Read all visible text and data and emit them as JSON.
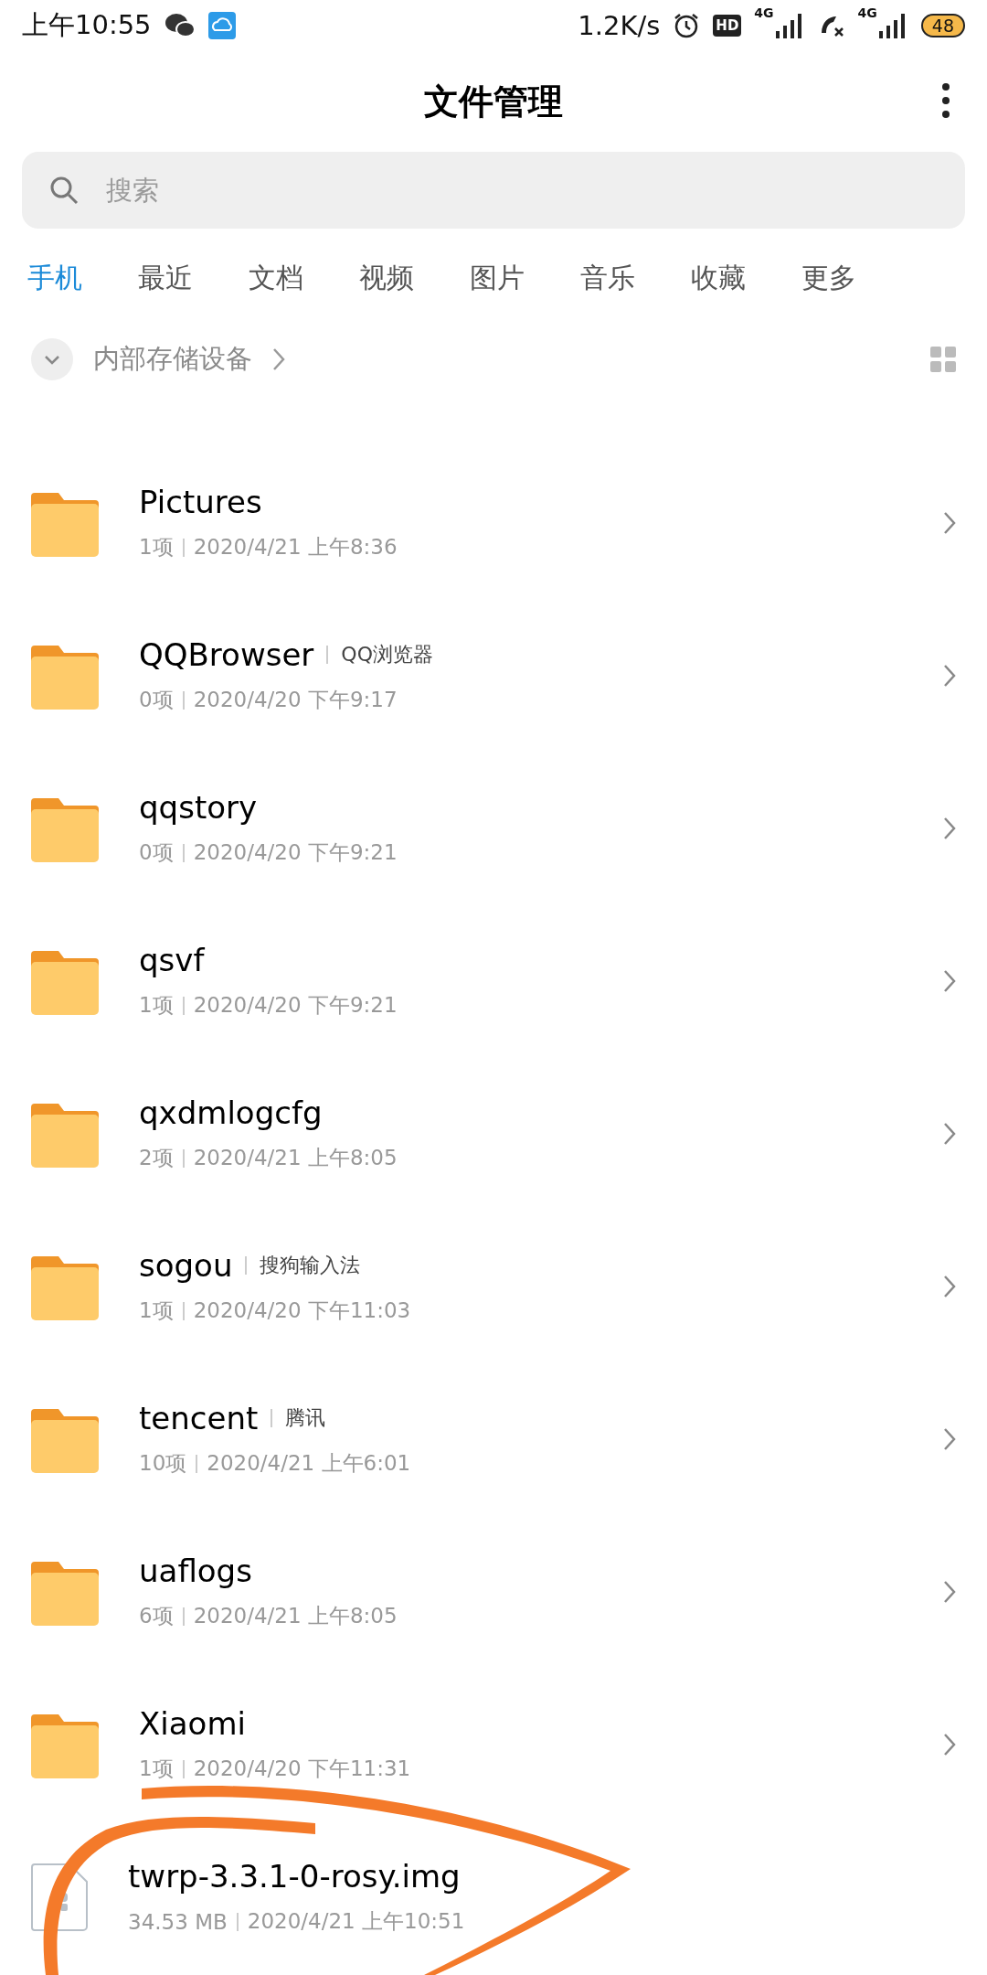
{
  "status_bar": {
    "time": "上午10:55",
    "speed": "1.2K/s",
    "hd": "HD",
    "sim1": "4G",
    "sim2": "4G",
    "battery": "48"
  },
  "header": {
    "title": "文件管理"
  },
  "search": {
    "placeholder": "搜索"
  },
  "tabs": [
    {
      "label": "手机",
      "selected": true
    },
    {
      "label": "最近",
      "selected": false
    },
    {
      "label": "文档",
      "selected": false
    },
    {
      "label": "视频",
      "selected": false
    },
    {
      "label": "图片",
      "selected": false
    },
    {
      "label": "音乐",
      "selected": false
    },
    {
      "label": "收藏",
      "selected": false
    },
    {
      "label": "更多",
      "selected": false
    }
  ],
  "breadcrumb": {
    "label": "内部存储设备"
  },
  "files": [
    {
      "kind": "folder",
      "name": "Pictures",
      "count": "1项",
      "date": "2020/4/21 上午8:36"
    },
    {
      "kind": "folder",
      "name": "QQBrowser",
      "tag": "QQ浏览器",
      "count": "0项",
      "date": "2020/4/20 下午9:17"
    },
    {
      "kind": "folder",
      "name": "qqstory",
      "count": "0项",
      "date": "2020/4/20 下午9:21"
    },
    {
      "kind": "folder",
      "name": "qsvf",
      "count": "1项",
      "date": "2020/4/20 下午9:21"
    },
    {
      "kind": "folder",
      "name": "qxdmlogcfg",
      "count": "2项",
      "date": "2020/4/21 上午8:05"
    },
    {
      "kind": "folder",
      "name": "sogou",
      "tag": "搜狗输入法",
      "count": "1项",
      "date": "2020/4/20 下午11:03"
    },
    {
      "kind": "folder",
      "name": "tencent",
      "tag": "腾讯",
      "count": "10项",
      "date": "2020/4/21 上午6:01"
    },
    {
      "kind": "folder",
      "name": "uaflogs",
      "count": "6项",
      "date": "2020/4/21 上午8:05"
    },
    {
      "kind": "folder",
      "name": "Xiaomi",
      "count": "1项",
      "date": "2020/4/20 下午11:31"
    },
    {
      "kind": "file",
      "name": "twrp-3.3.1-0-rosy.img",
      "count": "34.53 MB",
      "date": "2020/4/21 上午10:51"
    }
  ]
}
